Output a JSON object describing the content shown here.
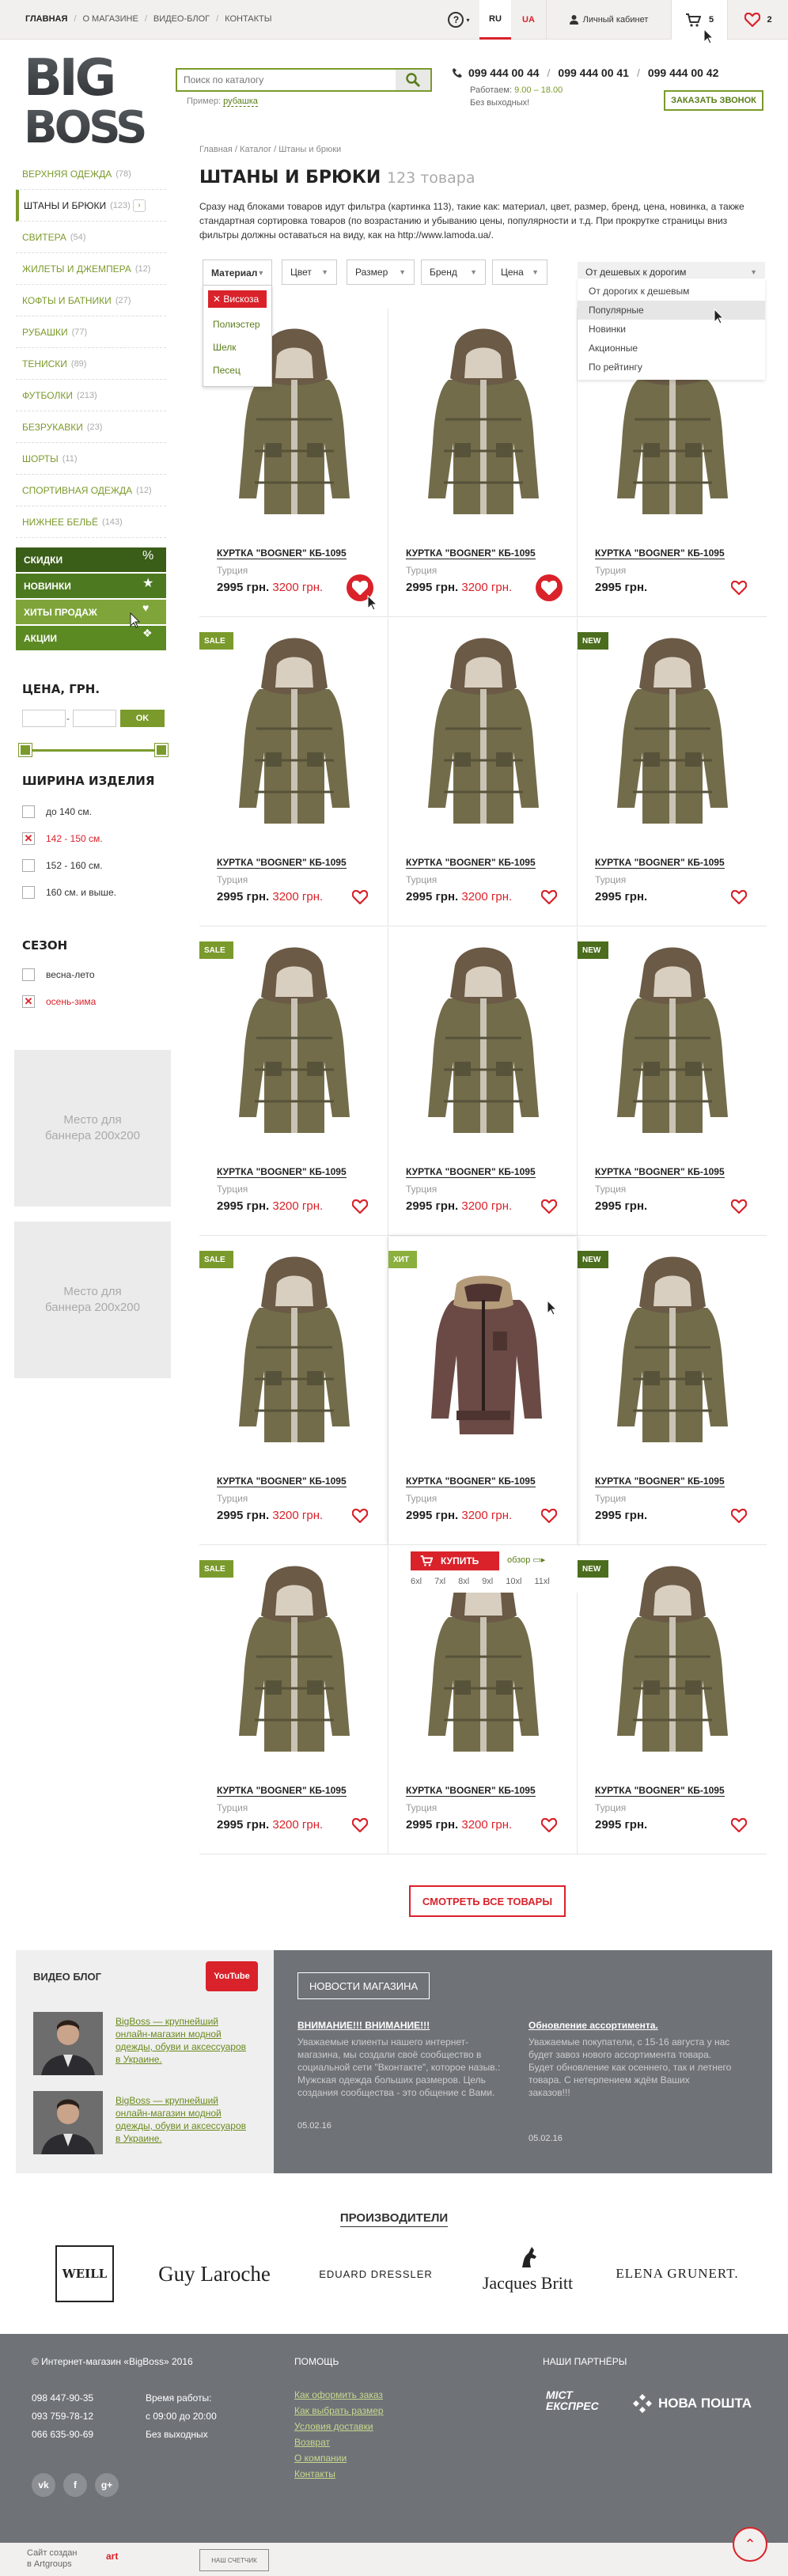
{
  "topbar": {
    "nav": [
      "ГЛАВНАЯ",
      "О МАГАЗИНЕ",
      "ВИДЕО-БЛОГ",
      "КОНТАКТЫ"
    ],
    "lang_ru": "RU",
    "lang_ua": "UA",
    "cabinet": "Личный кабинет",
    "cart_count": "5",
    "fav_count": "2"
  },
  "header": {
    "logo_line1": "BIG",
    "logo_line2": "BOSS",
    "search_placeholder": "Поиск по каталогу",
    "search_example_label": "Пример:",
    "search_example": "рубашка",
    "phones": [
      "099 444 00 44",
      "099 444 00 41",
      "099 444 00 42"
    ],
    "hours_label": "Работаем:",
    "hours_value": "9.00 – 18.00",
    "days_off": "Без выходных!",
    "callback": "ЗАКАЗАТЬ ЗВОНОК"
  },
  "sidebar": {
    "categories": [
      {
        "label": "ВЕРХНЯЯ ОДЕЖДА",
        "count": "(78)"
      },
      {
        "label": "ШТАНЫ И БРЮКИ",
        "count": "(123)"
      },
      {
        "label": "СВИТЕРА",
        "count": "(54)"
      },
      {
        "label": "ЖИЛЕТЫ И ДЖЕМПЕРА",
        "count": "(12)"
      },
      {
        "label": "КОФТЫ И БАТНИКИ",
        "count": "(27)"
      },
      {
        "label": "РУБАШКИ",
        "count": "(77)"
      },
      {
        "label": "ТЕНИСКИ",
        "count": "(89)"
      },
      {
        "label": "ФУТБОЛКИ",
        "count": "(213)"
      },
      {
        "label": "БЕЗРУКАВКИ",
        "count": "(23)"
      },
      {
        "label": "ШОРТЫ",
        "count": "(11)"
      },
      {
        "label": "СПОРТИВНАЯ ОДЕЖДА",
        "count": "(12)"
      },
      {
        "label": "НИЖНЕЕ БЕЛЬЁ",
        "count": "(143)"
      }
    ],
    "promo": [
      "СКИДКИ",
      "НОВИНКИ",
      "ХИТЫ ПРОДАЖ",
      "АКЦИИ"
    ],
    "price_title": "ЦЕНА, ГРН.",
    "ok": "OK",
    "width_title": "ШИРИНА ИЗДЕЛИЯ",
    "widths": [
      {
        "label": "до 140 см.",
        "checked": false
      },
      {
        "label": "142 - 150 см.",
        "checked": true
      },
      {
        "label": "152 - 160 см.",
        "checked": false
      },
      {
        "label": "160 см. и выше.",
        "checked": false
      }
    ],
    "season_title": "СЕЗОН",
    "seasons": [
      {
        "label": "весна-лето",
        "checked": false
      },
      {
        "label": "осень-зима",
        "checked": true
      }
    ],
    "banner_text": "Место для баннера 200x200"
  },
  "main": {
    "breadcrumb": "Главная / Каталог / Штаны и брюки",
    "title": "ШТАНЫ И БРЮКИ",
    "count": "123 товара",
    "description": "Сразу над блоками товаров идут фильтра (картинка 113), такие как: материал, цвет, размер, бренд, цена, новинка, а также стандартная сортировка товаров (по возрастанию и убыванию цены, популярности и т.д. При прокрутке страницы вниз фильтры должны оставаться на виду, как на http://www.lamoda.ua/.",
    "filters": [
      "Материал",
      "Цвет",
      "Размер",
      "Бренд",
      "Цена"
    ],
    "sort_selected": "От дешевых к дорогим",
    "material_options": [
      "Вискоза",
      "Полиэстер",
      "Шелк",
      "Песец"
    ],
    "sort_options": [
      "От дорогих к дешевым",
      "Популярные",
      "Новинки",
      "Акционные",
      "По рейтингу"
    ]
  },
  "products": [
    {
      "badge": "",
      "name": "КУРТКА \"BOGNER\" КБ-1095",
      "country": "Турция",
      "price": "2995 грн.",
      "new_price": "3200 грн.",
      "fav": true
    },
    {
      "badge": "",
      "name": "КУРТКА \"BOGNER\" КБ-1095",
      "country": "Турция",
      "price": "2995 грн.",
      "new_price": "3200 грн.",
      "fav": true
    },
    {
      "badge": "",
      "name": "КУРТКА \"BOGNER\" КБ-1095",
      "country": "Турция",
      "price": "2995 грн.",
      "new_price": "",
      "fav": false
    },
    {
      "badge": "SALE",
      "name": "КУРТКА \"BOGNER\" КБ-1095",
      "country": "Турция",
      "price": "2995 грн.",
      "new_price": "3200 грн.",
      "fav": false
    },
    {
      "badge": "",
      "name": "КУРТКА \"BOGNER\" КБ-1095",
      "country": "Турция",
      "price": "2995 грн.",
      "new_price": "3200 грн.",
      "fav": false
    },
    {
      "badge": "NEW",
      "name": "КУРТКА \"BOGNER\" КБ-1095",
      "country": "Турция",
      "price": "2995 грн.",
      "new_price": "",
      "fav": false
    },
    {
      "badge": "SALE",
      "name": "КУРТКА \"BOGNER\" КБ-1095",
      "country": "Турция",
      "price": "2995 грн.",
      "new_price": "3200 грн.",
      "fav": false
    },
    {
      "badge": "",
      "name": "КУРТКА \"BOGNER\" КБ-1095",
      "country": "Турция",
      "price": "2995 грн.",
      "new_price": "3200 грн.",
      "fav": false
    },
    {
      "badge": "NEW",
      "name": "КУРТКА \"BOGNER\" КБ-1095",
      "country": "Турция",
      "price": "2995 грн.",
      "new_price": "",
      "fav": false
    },
    {
      "badge": "SALE",
      "name": "КУРТКА \"BOGNER\" КБ-1095",
      "country": "Турция",
      "price": "2995 грн.",
      "new_price": "3200 грн.",
      "fav": false
    },
    {
      "badge": "ХИТ",
      "name": "КУРТКА \"BOGNER\" КБ-1095",
      "country": "Турция",
      "price": "2995 грн.",
      "new_price": "3200 грн.",
      "fav": false,
      "hover": true
    },
    {
      "badge": "NEW",
      "name": "КУРТКА \"BOGNER\" КБ-1095",
      "country": "Турция",
      "price": "2995 грн.",
      "new_price": "",
      "fav": false
    },
    {
      "badge": "SALE",
      "name": "КУРТКА \"BOGNER\" КБ-1095",
      "country": "Турция",
      "price": "2995 грн.",
      "new_price": "3200 грн.",
      "fav": false
    },
    {
      "badge": "",
      "name": "КУРТКА \"BOGNER\" КБ-1095",
      "country": "Турция",
      "price": "2995 грн.",
      "new_price": "3200 грн.",
      "fav": false
    },
    {
      "badge": "NEW",
      "name": "КУРТКА \"BOGNER\" КБ-1095",
      "country": "Турция",
      "price": "2995 грн.",
      "new_price": "",
      "fav": false
    }
  ],
  "hover_card": {
    "buy": "КУПИТЬ",
    "review": "обзор",
    "sizes": [
      "6xl",
      "7xl",
      "8xl",
      "9xl",
      "10xl",
      "11xl"
    ]
  },
  "all_goods": "СМОТРЕТЬ ВСЕ ТОВАРЫ",
  "video_blog": {
    "title": "ВИДЕО БЛОГ",
    "youtube": "YouTube",
    "items": [
      "BigBoss — крупнейший онлайн-магазин модной одежды, обуви и аксессуаров в Украине.",
      "BigBoss — крупнейший онлайн-магазин модной одежды, обуви и аксессуаров в Украине."
    ]
  },
  "news": {
    "button": "НОВОСТИ МАГАЗИНА",
    "items": [
      {
        "title": "ВНИМАНИЕ!!! ВНИМАНИЕ!!!",
        "body": "Уважаемые клиенты нашего интернет-магазина, мы создали своё сообщество в социальной сети \"Вконтакте\", которое назыв.: Мужская одежда больших размеров. Цель создания сообщества - это общение с Вами.",
        "date": "05.02.16"
      },
      {
        "title": "Обновление ассортимента.",
        "body": "Уважаемые покупатели, с 15-16 августа у нас будет завоз нового ассортимента товара. Будет обновление как осеннего, так и летнего товара. С нетерпением ждём Ваших заказов!!!",
        "date": "05.02.16"
      }
    ]
  },
  "brands": {
    "title": "ПРОИЗВОДИТЕЛИ",
    "items": [
      "WEILL",
      "Guy Laroche",
      "EDUARD DRESSLER",
      "Jacques Britt",
      "ELENA GRUNERT."
    ]
  },
  "footer": {
    "copyright": "© Интернет-магазин «BigBoss» 2016",
    "phones": [
      "098 447-90-35",
      "093 759-78-12",
      "066 635-90-69"
    ],
    "hours_title": "Время работы:",
    "hours": "с 09:00 до 20:00",
    "days_off": "Без выходных",
    "help_title": "ПОМОЩЬ",
    "help_links": [
      "Как оформить заказ",
      "Как выбрать размер",
      "Условия доставки",
      "Возврат",
      "О компании",
      "Контакты"
    ],
    "partners_title": "НАШИ ПАРТНЁРЫ",
    "partner1": "МІСТ ЕКСПРЕС",
    "partner2": "НОВА ПОШТА",
    "created_line1": "Сайт создан",
    "created_line2": "в Artgroups",
    "artgroups": "art",
    "counter": "НАШ СЧЕТЧИК",
    "social": [
      "vk",
      "f",
      "g+"
    ]
  }
}
